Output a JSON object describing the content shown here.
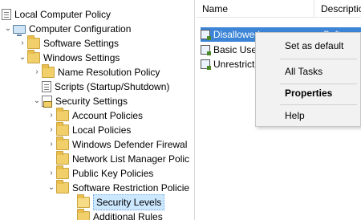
{
  "tree": {
    "items": [
      {
        "label": "Local Computer Policy",
        "icon": "doc-icon",
        "chev": "",
        "indent": 0
      },
      {
        "label": "Computer Configuration",
        "icon": "computer-icon",
        "chev": "⌄",
        "indent": 1
      },
      {
        "label": "Software Settings",
        "icon": "folder-icon",
        "chev": "›",
        "indent": 2
      },
      {
        "label": "Windows Settings",
        "icon": "folder-icon",
        "chev": "⌄",
        "indent": 2
      },
      {
        "label": "Name Resolution Policy",
        "icon": "folder-icon",
        "chev": "›",
        "indent": 3
      },
      {
        "label": "Scripts (Startup/Shutdown)",
        "icon": "doc-icon",
        "chev": "",
        "indent": 3
      },
      {
        "label": "Security Settings",
        "icon": "security-icon",
        "chev": "⌄",
        "indent": 3
      },
      {
        "label": "Account Policies",
        "icon": "folder-icon",
        "chev": "›",
        "indent": 4
      },
      {
        "label": "Local Policies",
        "icon": "folder-icon",
        "chev": "›",
        "indent": 4
      },
      {
        "label": "Windows Defender Firewal",
        "icon": "folder-icon",
        "chev": "›",
        "indent": 4
      },
      {
        "label": "Network List Manager Polic",
        "icon": "folder-icon",
        "chev": "",
        "indent": 4
      },
      {
        "label": "Public Key Policies",
        "icon": "folder-icon",
        "chev": "›",
        "indent": 4
      },
      {
        "label": "Software Restriction Policie",
        "icon": "folder-icon",
        "chev": "⌄",
        "indent": 4
      },
      {
        "label": "Security Levels",
        "icon": "folder-open-icon",
        "chev": "",
        "indent": 5
      },
      {
        "label": "Additional Rules",
        "icon": "folder-icon",
        "chev": "",
        "indent": 5
      }
    ]
  },
  "list": {
    "columns": [
      "Name",
      "Descriptio"
    ],
    "rows": [
      {
        "name": "Disallowed",
        "desc": "Software"
      },
      {
        "name": "Basic User",
        "desc": ""
      },
      {
        "name": "Unrestrict",
        "desc": ""
      }
    ]
  },
  "context_menu": {
    "items": [
      "Set as default",
      "All Tasks",
      "Properties",
      "Help"
    ]
  }
}
